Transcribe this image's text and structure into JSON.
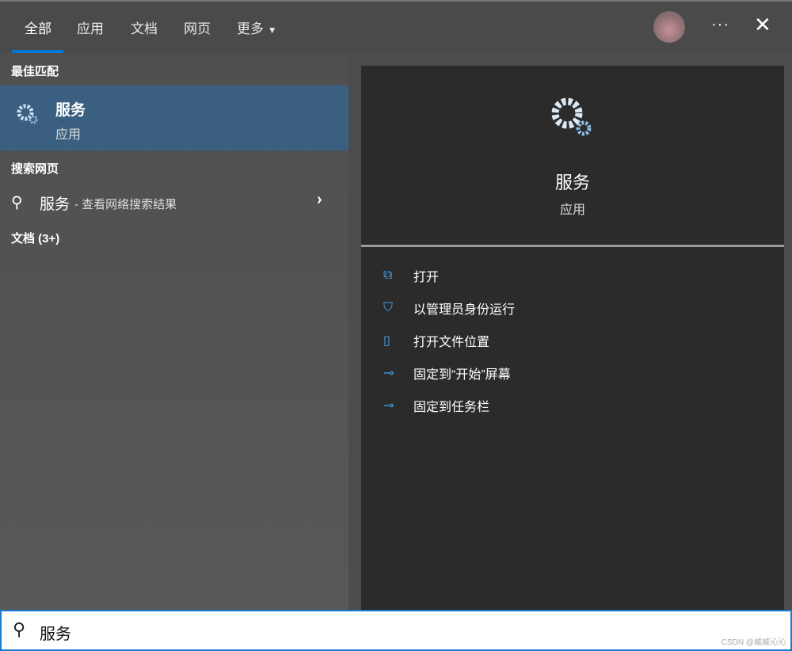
{
  "tabs": [
    {
      "label": "全部"
    },
    {
      "label": "应用"
    },
    {
      "label": "文档"
    },
    {
      "label": "网页"
    },
    {
      "label": "更多"
    }
  ],
  "header": {
    "more_label": "···",
    "close_label": "✕"
  },
  "left": {
    "best_match_heading": "最佳匹配",
    "best_match": {
      "title": "服务",
      "subtitle": "应用"
    },
    "web_heading": "搜索网页",
    "web_result": {
      "query": "服务",
      "suffix": "- 查看网络搜索结果"
    },
    "docs_heading": "文档 (3+)"
  },
  "right": {
    "title": "服务",
    "subtitle": "应用",
    "actions": [
      {
        "label": "打开",
        "icon": "open-icon"
      },
      {
        "label": "以管理员身份运行",
        "icon": "admin-shield-icon"
      },
      {
        "label": "打开文件位置",
        "icon": "file-location-icon"
      },
      {
        "label": "固定到“开始”屏幕",
        "icon": "pin-icon"
      },
      {
        "label": "固定到任务栏",
        "icon": "pin-icon"
      }
    ]
  },
  "search": {
    "value": "服务"
  },
  "watermark": "CSDN @威威沁沁",
  "colors": {
    "accent": "#0078d7",
    "selected": "#3a5f80"
  }
}
